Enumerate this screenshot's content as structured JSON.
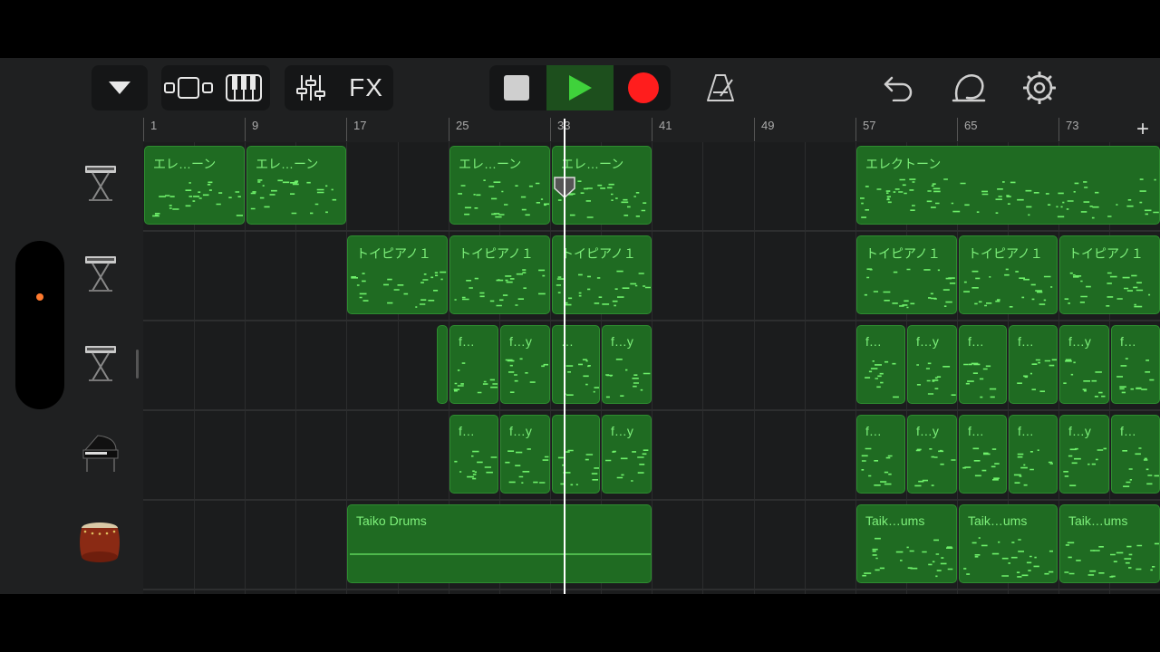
{
  "toolbar": {
    "fx_label": "FX",
    "icons": [
      "track-menu-icon",
      "browser-view-icon",
      "keyboard-icon",
      "mixer-icon",
      "fx",
      "stop-icon",
      "play-icon",
      "record-icon",
      "metronome-icon",
      "undo-icon",
      "loop-icon",
      "settings-icon"
    ],
    "colors": {
      "play": "#3fd23b",
      "record": "#ff1d1d",
      "play_bg": "#1d4f1d"
    }
  },
  "ruler": {
    "bars": [
      "1",
      "9",
      "17",
      "25",
      "33",
      "41",
      "49",
      "57",
      "65",
      "73"
    ],
    "add_label": "+"
  },
  "tracks": [
    {
      "icon": "electone-keyboard-icon",
      "regions": [
        {
          "label": "エレ…ーン"
        },
        {
          "label": "エレ…ーン"
        },
        {
          "label": "エレ…ーン"
        },
        {
          "label": "エレ…ーン"
        },
        {
          "label": "エレクトーン"
        }
      ]
    },
    {
      "icon": "toy-piano-keyboard-icon",
      "regions": [
        {
          "label": "トイピアノ１"
        },
        {
          "label": "トイピアノ１"
        },
        {
          "label": "トイピアノ１"
        },
        {
          "label": "トイピアノ１"
        },
        {
          "label": "トイピアノ１"
        },
        {
          "label": "トイピアノ１"
        }
      ]
    },
    {
      "icon": "keyboard-stand-icon",
      "regions": [
        {
          "label": ""
        },
        {
          "label": "f…"
        },
        {
          "label": "f…y"
        },
        {
          "label": "…"
        },
        {
          "label": "f…y"
        },
        {
          "label": "f…"
        },
        {
          "label": "f…y"
        },
        {
          "label": "f…"
        },
        {
          "label": "f…"
        },
        {
          "label": "f…y"
        },
        {
          "label": "f…"
        }
      ]
    },
    {
      "icon": "grand-piano-icon",
      "regions": [
        {
          "label": "f…"
        },
        {
          "label": "f…y"
        },
        {
          "label": ""
        },
        {
          "label": "f…y"
        },
        {
          "label": "f…"
        },
        {
          "label": "f…y"
        },
        {
          "label": "f…"
        },
        {
          "label": "f…"
        },
        {
          "label": "f…y"
        },
        {
          "label": "f…"
        }
      ]
    },
    {
      "icon": "taiko-drum-icon",
      "regions": [
        {
          "label": "Taiko Drums"
        },
        {
          "label": "Taik…ums"
        },
        {
          "label": "Taik…ums"
        },
        {
          "label": "Taik…ums"
        }
      ]
    }
  ]
}
